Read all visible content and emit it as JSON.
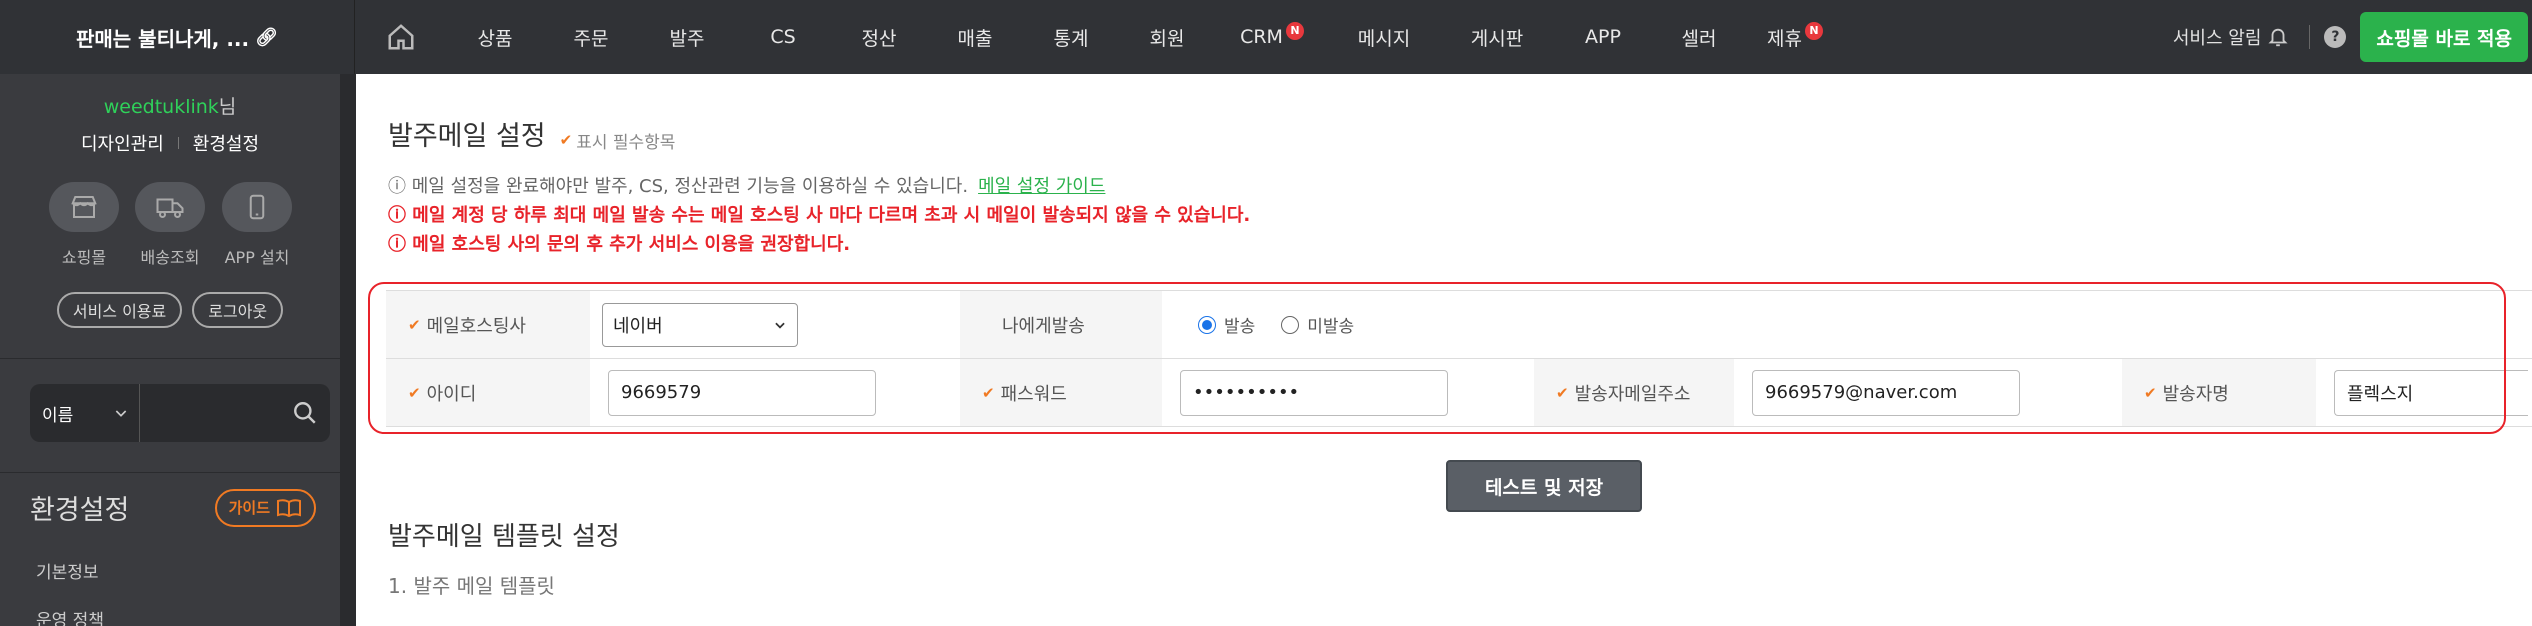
{
  "brand": {
    "title": "판매는 불티나게, ..."
  },
  "nav": {
    "items": [
      {
        "label": "상품",
        "badge": ""
      },
      {
        "label": "주문",
        "badge": ""
      },
      {
        "label": "발주",
        "badge": ""
      },
      {
        "label": "CS",
        "badge": ""
      },
      {
        "label": "정산",
        "badge": ""
      },
      {
        "label": "매출",
        "badge": ""
      },
      {
        "label": "통계",
        "badge": ""
      },
      {
        "label": "회원",
        "badge": ""
      },
      {
        "label": "CRM",
        "badge": "N"
      },
      {
        "label": "메시지",
        "badge": ""
      },
      {
        "label": "게시판",
        "badge": ""
      },
      {
        "label": "APP",
        "badge": ""
      },
      {
        "label": "셀러",
        "badge": ""
      },
      {
        "label": "제휴",
        "badge": "N"
      }
    ],
    "service_alert": "서비스 알림",
    "help": "?",
    "apply_button": "쇼핑몰 바로 적용"
  },
  "sidebar": {
    "user_id": "weedtuklink",
    "user_suffix": "님",
    "design_link": "디자인관리",
    "settings_link": "환경설정",
    "quick": [
      {
        "label": "쇼핑몰",
        "icon": "store-icon"
      },
      {
        "label": "배송조회",
        "icon": "truck-icon"
      },
      {
        "label": "APP 설치",
        "icon": "phone-icon"
      }
    ],
    "service_fee": "서비스 이용료",
    "logout": "로그아웃",
    "search_select": "이름",
    "section_title": "환경설정",
    "guide_button": "가이드",
    "menu": [
      "기본정보",
      "운영 정책"
    ]
  },
  "main": {
    "title": "발주메일 설정",
    "required_note": "표시 필수항목",
    "info_gray": "ⓘ 메일 설정을 완료해야만 발주, CS, 정산관련 기능을 이용하실 수 있습니다.",
    "guide_link": "메일 설정 가이드",
    "info_red_1": "ⓘ 메일 계정 당 하루 최대 메일 발송 수는 메일 호스팅 사 마다 다르며 초과 시 메일이 발송되지 않을 수 있습니다.",
    "info_red_2": "ⓘ 메일 호스팅 사의 문의 후 추가 서비스 이용을 권장합니다.",
    "form": {
      "host_label": "메일호스팅사",
      "host_value": "네이버",
      "self_send_label": "나에게발송",
      "radio_send": "발송",
      "radio_nosend": "미발송",
      "id_label": "아이디",
      "id_value": "9669579",
      "pw_label": "패스워드",
      "pw_value": "••••••••••",
      "sender_email_label": "발송자메일주소",
      "sender_email_value": "9669579@naver.com",
      "sender_name_label": "발송자명",
      "sender_name_value": "플렉스지"
    },
    "test_button": "테스트 및 저장",
    "template_title": "발주메일 템플릿 설정",
    "template_sub": "1. 발주 메일 템플릿"
  }
}
